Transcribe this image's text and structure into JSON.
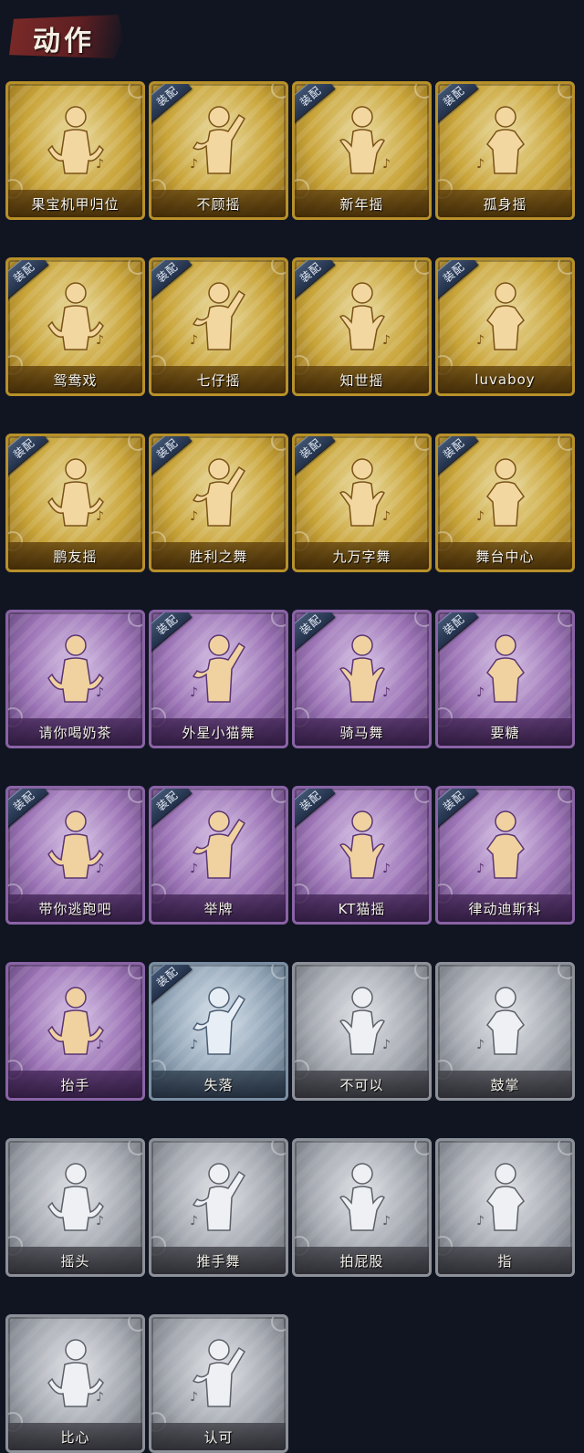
{
  "header": {
    "title": "动作"
  },
  "badge_label": "装配",
  "colors": {
    "gold": "#c9a53a",
    "purple": "#9c74b6",
    "blue": "#93a6b8",
    "gray": "#a5a9b1",
    "background": "#101521",
    "title_banner": "#7b2a28"
  },
  "actions": [
    {
      "label": "果宝机甲归位",
      "rarity": "gold",
      "equipped": false,
      "icon": "hands-on-hips-figure-icon"
    },
    {
      "label": "不顾摇",
      "rarity": "gold",
      "equipped": true,
      "icon": "pointing-dance-figure-icon"
    },
    {
      "label": "新年摇",
      "rarity": "gold",
      "equipped": true,
      "icon": "fist-dance-figure-icon"
    },
    {
      "label": "孤身摇",
      "rarity": "gold",
      "equipped": true,
      "icon": "star-hands-figure-icon"
    },
    {
      "label": "鸳鸯戏",
      "rarity": "gold",
      "equipped": true,
      "icon": "music-dance-figure-icon"
    },
    {
      "label": "七仔摇",
      "rarity": "gold",
      "equipped": true,
      "icon": "sparkle-dance-figure-icon"
    },
    {
      "label": "知世摇",
      "rarity": "gold",
      "equipped": true,
      "icon": "shrug-dance-figure-icon"
    },
    {
      "label": "luvaboy",
      "rarity": "gold",
      "equipped": true,
      "icon": "cross-arms-figure-icon"
    },
    {
      "label": "鹏友摇",
      "rarity": "gold",
      "equipped": true,
      "icon": "wave-dance-figure-icon"
    },
    {
      "label": "胜利之舞",
      "rarity": "gold",
      "equipped": true,
      "icon": "victory-pose-figure-icon"
    },
    {
      "label": "九万字舞",
      "rarity": "gold",
      "equipped": true,
      "icon": "swirl-dance-figure-icon"
    },
    {
      "label": "舞台中心",
      "rarity": "gold",
      "equipped": true,
      "icon": "spotlight-pose-figure-icon"
    },
    {
      "label": "请你喝奶茶",
      "rarity": "purple",
      "equipped": false,
      "icon": "holding-sign-figure-icon"
    },
    {
      "label": "外星小猫舞",
      "rarity": "purple",
      "equipped": true,
      "icon": "cat-dance-figure-icon"
    },
    {
      "label": "骑马舞",
      "rarity": "purple",
      "equipped": true,
      "icon": "horse-dance-figure-icon"
    },
    {
      "label": "要糖",
      "rarity": "purple",
      "equipped": true,
      "icon": "reaching-figure-icon"
    },
    {
      "label": "带你逃跑吧",
      "rarity": "purple",
      "equipped": true,
      "icon": "run-away-figure-icon"
    },
    {
      "label": "举牌",
      "rarity": "purple",
      "equipped": true,
      "icon": "raise-sign-figure-icon"
    },
    {
      "label": "KT猫摇",
      "rarity": "purple",
      "equipped": true,
      "icon": "kt-cat-dance-figure-icon"
    },
    {
      "label": "律动迪斯科",
      "rarity": "purple",
      "equipped": true,
      "icon": "disco-pose-figure-icon"
    },
    {
      "label": "抬手",
      "rarity": "purple",
      "equipped": false,
      "icon": "raise-hand-figure-icon"
    },
    {
      "label": "失落",
      "rarity": "blue",
      "equipped": true,
      "icon": "kneeling-figure-icon"
    },
    {
      "label": "不可以",
      "rarity": "gray",
      "equipped": false,
      "icon": "finger-wag-icon"
    },
    {
      "label": "鼓掌",
      "rarity": "gray",
      "equipped": false,
      "icon": "clapping-hands-icon"
    },
    {
      "label": "摇头",
      "rarity": "gray",
      "equipped": false,
      "icon": "head-shake-figure-icon"
    },
    {
      "label": "推手舞",
      "rarity": "gray",
      "equipped": false,
      "icon": "push-hands-figure-icon"
    },
    {
      "label": "拍屁股",
      "rarity": "gray",
      "equipped": false,
      "icon": "pat-butt-figure-icon"
    },
    {
      "label": "指",
      "rarity": "gray",
      "equipped": false,
      "icon": "pointing-hand-icon"
    },
    {
      "label": "比心",
      "rarity": "gray",
      "equipped": false,
      "icon": "finger-heart-icon"
    },
    {
      "label": "认可",
      "rarity": "gray",
      "equipped": false,
      "icon": "thumbs-up-icon"
    }
  ]
}
